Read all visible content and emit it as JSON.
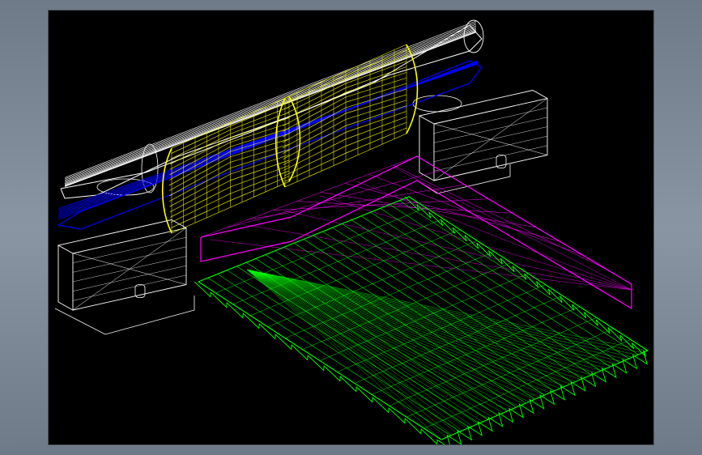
{
  "colors": {
    "frame": "#7f8a97",
    "viewport_bg": "#000000",
    "outline": "#ffffff",
    "blue_roll": "#0000ff",
    "pillows": "#ffff00",
    "bed_frame": "#ff00ff",
    "mattress": "#00ff00"
  },
  "objects": [
    "headboard-roll",
    "blue-roll",
    "pillows",
    "left-nightstand",
    "right-nightstand",
    "bed-frame",
    "mattress"
  ]
}
